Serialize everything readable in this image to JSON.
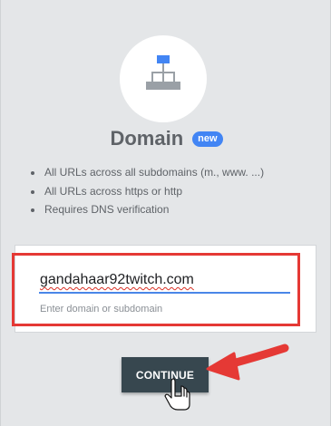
{
  "card": {
    "title": "Domain",
    "badge": "new",
    "icon": "sitemap-icon",
    "accent_color": "#4285f4",
    "bullets": [
      "All URLs across all subdomains (m., www. ...)",
      "All URLs across https or http",
      "Requires DNS verification"
    ]
  },
  "domain_input": {
    "value": "gandahaar92twitch.com",
    "helper_text": "Enter domain or subdomain"
  },
  "continue_button": {
    "label": "CONTINUE"
  },
  "annotations": {
    "highlight_color": "#e53935",
    "arrow_icon": "red-arrow-icon",
    "cursor_icon": "hand-pointer-icon"
  }
}
